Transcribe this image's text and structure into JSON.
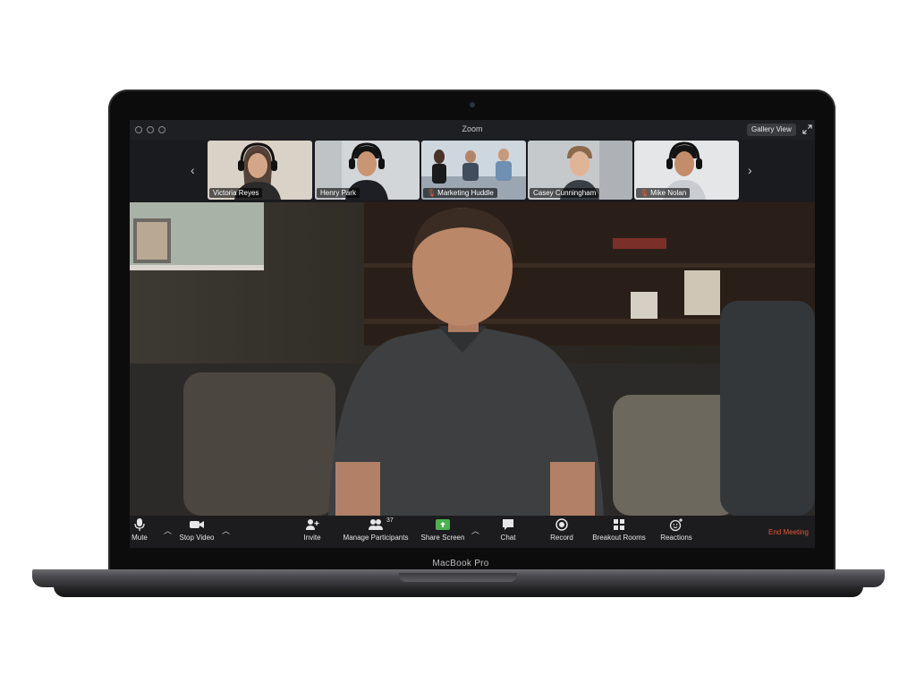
{
  "device": {
    "label": "MacBook Pro"
  },
  "window": {
    "title": "Zoom",
    "view_button": "Gallery View"
  },
  "participants": [
    {
      "name": "Victoria Reyes",
      "muted": false,
      "bg": "#d9d2c6"
    },
    {
      "name": "Henry Park",
      "muted": false,
      "bg": "#d3d6d9"
    },
    {
      "name": "Marketing Huddle",
      "muted": true,
      "bg": "#cfd7de"
    },
    {
      "name": "Casey Cunningham",
      "muted": false,
      "bg": "#c6c9cc"
    },
    {
      "name": "Mike Nolan",
      "muted": true,
      "bg": "#e4e6e8"
    }
  ],
  "toolbar": {
    "mute": "Mute",
    "stop_video": "Stop Video",
    "invite": "Invite",
    "manage_participants": "Manage Participants",
    "participant_count": "37",
    "share_screen": "Share Screen",
    "chat": "Chat",
    "record": "Record",
    "breakout_rooms": "Breakout Rooms",
    "reactions": "Reactions",
    "end_meeting": "End Meeting"
  },
  "colors": {
    "end_meeting": "#e5573b",
    "share_screen_icon": "#4caf50",
    "muted_indicator": "#e2602b"
  }
}
